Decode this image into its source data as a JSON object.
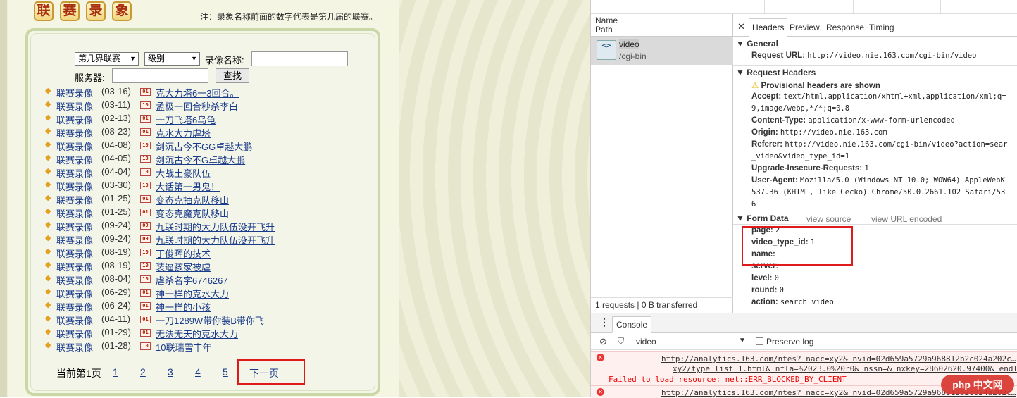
{
  "left": {
    "title_chars": [
      "联",
      "赛",
      "录",
      "象"
    ],
    "note": "注：录象名称前面的数字代表是第几届的联赛。",
    "filters": {
      "season_select": "第几界联赛",
      "level_select": "级别",
      "name_label": "录像名称:",
      "server_label": "服务器:",
      "search_button": "查找"
    },
    "records": [
      {
        "cat": "联赛录像",
        "date": "(03-16)",
        "badge": "01",
        "title": "克大力塔6一3回合。"
      },
      {
        "cat": "联赛录像",
        "date": "(03-11)",
        "badge": "10",
        "title": "孟极一回合秒杀李白"
      },
      {
        "cat": "联赛录像",
        "date": "(02-13)",
        "badge": "01",
        "title": "一刀飞塔6乌龟"
      },
      {
        "cat": "联赛录像",
        "date": "(08-23)",
        "badge": "01",
        "title": "克水大力虐塔"
      },
      {
        "cat": "联赛录像",
        "date": "(04-08)",
        "badge": "10",
        "title": "剑沉古今不GG卓越大鹏"
      },
      {
        "cat": "联赛录像",
        "date": "(04-05)",
        "badge": "10",
        "title": "剑沉古今不G卓越大鹏"
      },
      {
        "cat": "联赛录像",
        "date": "(04-04)",
        "badge": "10",
        "title": "大战土豪队伍"
      },
      {
        "cat": "联赛录像",
        "date": "(03-30)",
        "badge": "10",
        "title": "大话第一男鬼！"
      },
      {
        "cat": "联赛录像",
        "date": "(01-25)",
        "badge": "01",
        "title": "变态克抽克队移山"
      },
      {
        "cat": "联赛录像",
        "date": "(01-25)",
        "badge": "01",
        "title": "变态克魔克队移山"
      },
      {
        "cat": "联赛录像",
        "date": "(09-24)",
        "badge": "09",
        "title": "九联时期的大力队伍没开飞升"
      },
      {
        "cat": "联赛录像",
        "date": "(09-24)",
        "badge": "09",
        "title": "九联时期的大力队伍没开飞升"
      },
      {
        "cat": "联赛录像",
        "date": "(08-19)",
        "badge": "10",
        "title": "丁俊晖的技术"
      },
      {
        "cat": "联赛录像",
        "date": "(08-19)",
        "badge": "10",
        "title": "装逼孩家被虐"
      },
      {
        "cat": "联赛录像",
        "date": "(08-04)",
        "badge": "10",
        "title": "虐杀名字6746267"
      },
      {
        "cat": "联赛录像",
        "date": "(06-29)",
        "badge": "01",
        "title": "神一样的克水大力"
      },
      {
        "cat": "联赛录像",
        "date": "(06-24)",
        "badge": "01",
        "title": "神一样的小孩"
      },
      {
        "cat": "联赛录像",
        "date": "(04-11)",
        "badge": "01",
        "title": "一刀1289W带你装B带你飞"
      },
      {
        "cat": "联赛录像",
        "date": "(01-29)",
        "badge": "01",
        "title": "无法无天的克水大力"
      },
      {
        "cat": "联赛录像",
        "date": "(01-28)",
        "badge": "10",
        "title": "10联瑞雪丰年"
      }
    ],
    "pager": {
      "current": "当前第1页",
      "pages": [
        "1",
        "2",
        "3",
        "4",
        "5"
      ],
      "next": "下一页"
    }
  },
  "devtools": {
    "name_header": "Name",
    "path_header": "Path",
    "request": {
      "name": "video",
      "path": "/cgi-bin"
    },
    "status": "1 requests  |  0 B transferred",
    "tabs": [
      "Headers",
      "Preview",
      "Response",
      "Timing"
    ],
    "general": {
      "title": "General",
      "request_url_key": "Request URL:",
      "request_url": "http://video.nie.163.com/cgi-bin/video"
    },
    "request_headers": {
      "title": "Request Headers",
      "warning": "Provisional headers are shown",
      "items": [
        {
          "k": "Accept:",
          "v": "text/html,application/xhtml+xml,application/xml;q="
        },
        {
          "k": "",
          "v": "9,image/webp,*/*;q=0.8"
        },
        {
          "k": "Content-Type:",
          "v": "application/x-www-form-urlencoded"
        },
        {
          "k": "Origin:",
          "v": "http://video.nie.163.com"
        },
        {
          "k": "Referer:",
          "v": "http://video.nie.163.com/cgi-bin/video?action=sear"
        },
        {
          "k": "",
          "v": "_video&video_type_id=1"
        },
        {
          "k": "Upgrade-Insecure-Requests:",
          "v": "1"
        },
        {
          "k": "User-Agent:",
          "v": "Mozilla/5.0 (Windows NT 10.0; WOW64) AppleWebK"
        },
        {
          "k": "",
          "v": "537.36 (KHTML, like Gecko) Chrome/50.0.2661.102 Safari/53"
        },
        {
          "k": "",
          "v": "6"
        }
      ]
    },
    "form_data": {
      "title": "Form Data",
      "view_source": "view source",
      "view_url_encoded": "view URL encoded",
      "items": [
        {
          "k": "page:",
          "v": "2"
        },
        {
          "k": "video_type_id:",
          "v": "1"
        },
        {
          "k": "name:",
          "v": ""
        },
        {
          "k": "server:",
          "v": ""
        },
        {
          "k": "level:",
          "v": "0"
        },
        {
          "k": "round:",
          "v": "0"
        },
        {
          "k": "action:",
          "v": "search_video"
        }
      ]
    },
    "console": {
      "tab": "Console",
      "filter_value": "video",
      "preserve_log": "Preserve log",
      "errors": [
        {
          "url": "http://analytics.163.com/ntes?_nacc=xy2&_nvid=02d659a5729a968812b2c024a202c…",
          "url2": "xy2/type_list_1.html&_nfla=%2023.0%20r0&_nssn=&_nxkey=28602620.97400&_endl",
          "msg": "Failed to load resource: net::ERR_BLOCKED_BY_CLIENT"
        },
        {
          "url": "http://analytics.163.com/ntes?_nacc=xy2&_nvid=02d659a5729a968812b2c024a202c…",
          "url2": "",
          "msg": ""
        }
      ]
    }
  },
  "watermark": "php 中文网",
  "colors": {
    "highlight_box": "#e0191b",
    "link": "#1a3a8a",
    "error": "#e00000"
  }
}
